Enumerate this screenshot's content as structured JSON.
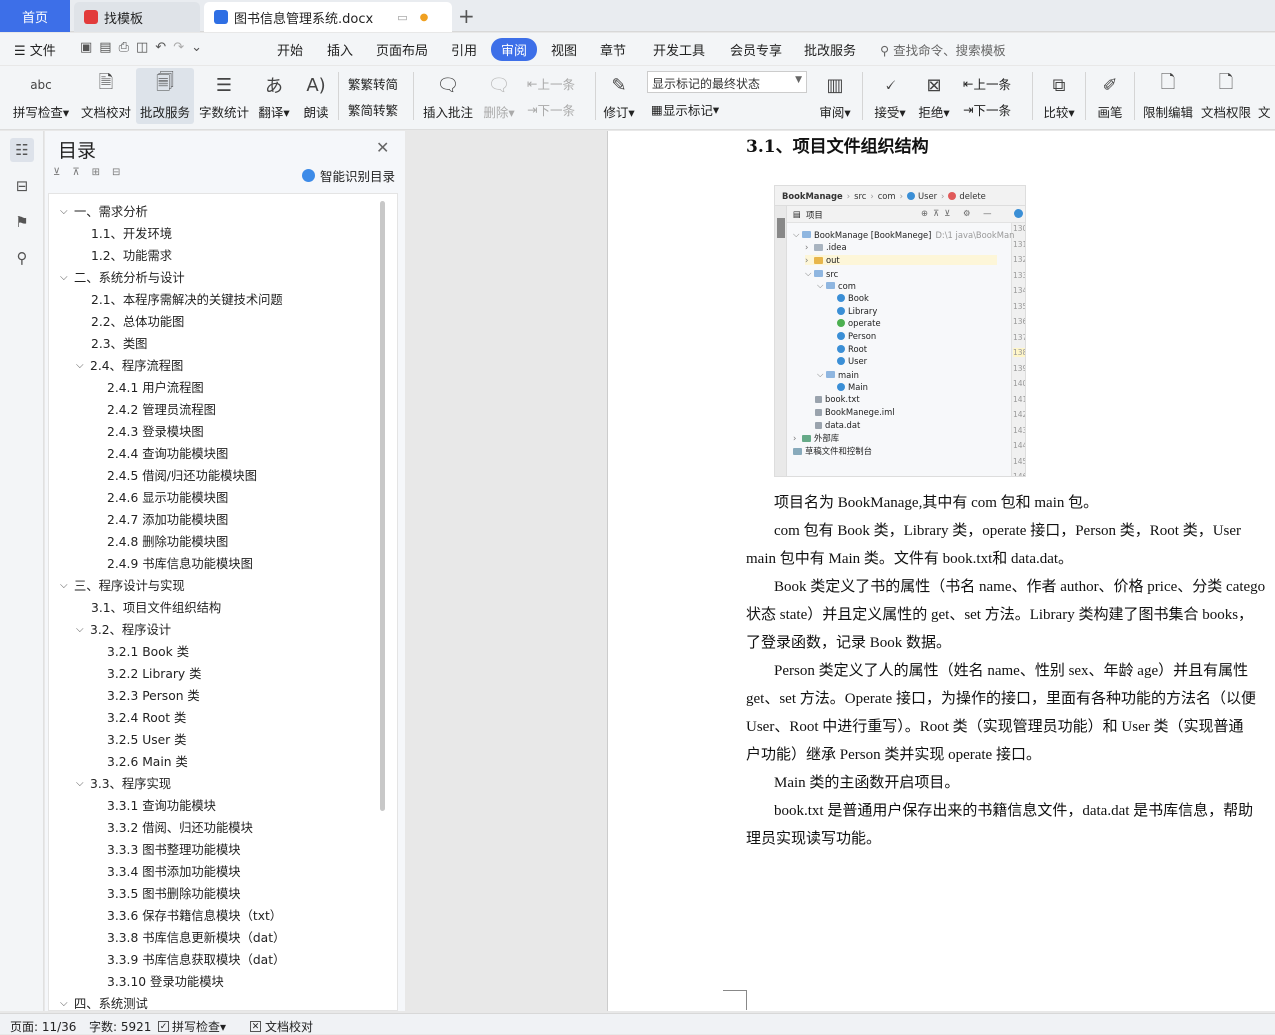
{
  "tabs": {
    "home": "首页",
    "template": "找模板",
    "doc": "图书信息管理系统.docx"
  },
  "menu": {
    "file": "文件",
    "items": [
      "开始",
      "插入",
      "页面布局",
      "引用",
      "审阅",
      "视图",
      "章节",
      "开发工具",
      "会员专享",
      "批改服务"
    ],
    "search_placeholder": "查找命令、搜索模板"
  },
  "ribbon": {
    "spell": "拼写检查",
    "proof": "文档校对",
    "grade": "批改服务",
    "wordcount": "字数统计",
    "translate": "翻译",
    "read": "朗读",
    "trad": "繁转简",
    "simp": "简转繁",
    "insert_comment": "插入批注",
    "delete": "删除",
    "prev": "上一条",
    "next": "下一条",
    "revise": "修订",
    "mark_state": "显示标记的最终状态",
    "show_marks": "显示标记",
    "review": "审阅",
    "accept": "接受",
    "reject": "拒绝",
    "prev2": "上一条",
    "next2": "下一条",
    "compare": "比较",
    "pen": "画笔",
    "restrict": "限制编辑",
    "perm": "文档权限",
    "more": "文"
  },
  "toc": {
    "title": "目录",
    "ai_button": "智能识别目录",
    "items": [
      "一、需求分析",
      "1.1、开发环境",
      "1.2、功能需求",
      "二、系统分析与设计",
      "2.1、本程序需解决的关键技术问题",
      "2.2、总体功能图",
      "2.3、类图",
      "2.4、程序流程图",
      "2.4.1  用户流程图",
      "2.4.2  管理员流程图",
      "2.4.3  登录模块图",
      "2.4.4  查询功能模块图",
      "2.4.5 借阅/归还功能模块图",
      "2.4.6 显示功能模块图",
      "2.4.7 添加功能模块图",
      "2.4.8 删除功能模块图",
      "2.4.9  书库信息功能模块图",
      "三、程序设计与实现",
      "3.1、项目文件组织结构",
      "3.2、程序设计",
      "3.2.1 Book 类",
      "3.2.2 Library 类",
      "3.2.3 Person 类",
      "3.2.4    Root 类",
      "3.2.5 User 类",
      "3.2.6 Main 类",
      "3.3、程序实现",
      "3.3.1 查询功能模块",
      "3.3.2 借阅、归还功能模块",
      "3.3.3  图书整理功能模块",
      "3.3.4  图书添加功能模块",
      "3.3.5  图书删除功能模块",
      "3.3.6 保存书籍信息模块（txt）",
      "3.3.8 书库信息更新模块（dat）",
      "3.3.9 书库信息获取模块（dat）",
      "3.3.10  登录功能模块",
      "四、系统测试"
    ]
  },
  "doc": {
    "heading": "3.1、项目文件组织结构",
    "lines": [
      "项目名为 BookManage,其中有 com 包和 main 包。",
      "com 包有 Book 类，Library 类，operate 接口，Person 类，Root 类，User",
      "main 包中有 Main 类。文件有 book.txt和 data.dat。",
      "Book 类定义了书的属性（书名 name、作者 author、价格 price、分类 catego",
      "状态 state）并且定义属性的 get、set 方法。Library 类构建了图书集合 books，",
      "了登录函数，记录 Book 数据。",
      "Person 类定义了人的属性（姓名 name、性别 sex、年龄 age）并且有属性",
      "get、set 方法。Operate 接口，为操作的接口，里面有各种功能的方法名（以便",
      "User、Root 中进行重写）。Root 类（实现管理员功能）和 User 类（实现普通",
      "户功能）继承 Person 类并实现 operate 接口。",
      "Main 类的主函数开启项目。",
      "book.txt 是普通用户保存出来的书籍信息文件，data.dat 是书库信息，帮助",
      "理员实现读写功能。"
    ]
  },
  "ide": {
    "crumbs": [
      "BookManage",
      "src",
      "com",
      "User",
      "delete"
    ],
    "tool_label": "项目",
    "tree": [
      "BookManage [BookManege]",
      "D:\\1 java\\BookMan",
      ".idea",
      "out",
      "src",
      "com",
      "Book",
      "Library",
      "operate",
      "Person",
      "Root",
      "User",
      "main",
      "Main",
      "book.txt",
      "BookManege.iml",
      "data.dat",
      "外部库",
      "草稿文件和控制台"
    ],
    "line_numbers": [
      "130",
      "131",
      "132",
      "133",
      "134",
      "135",
      "136",
      "137",
      "138",
      "139",
      "140",
      "141",
      "142",
      "143",
      "144",
      "145",
      "146"
    ]
  },
  "status": {
    "page": "页面: 11/36",
    "words": "字数: 5921",
    "spell": "拼写检查",
    "proof": "文档校对"
  },
  "colors": {
    "accent": "#3d6fe8",
    "class_icon": "#3b8fd6",
    "interface_icon": "#4caf50",
    "folder": "#e8b64b"
  }
}
